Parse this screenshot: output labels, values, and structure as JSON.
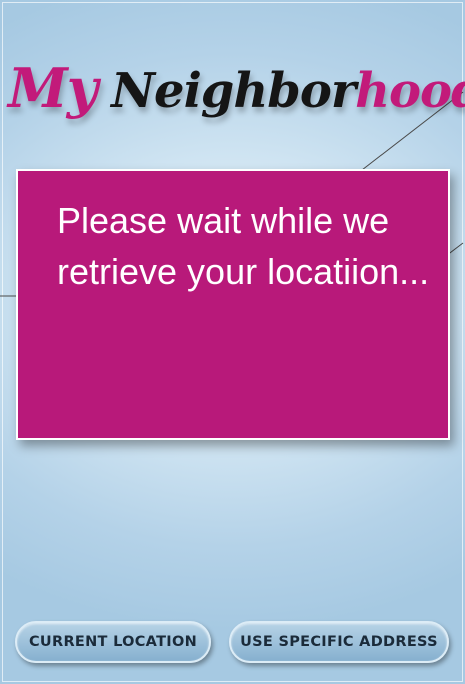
{
  "app": {
    "logo": {
      "part1": "My",
      "part2": "Neighbor",
      "part3": "hood"
    }
  },
  "dialog": {
    "message": "Please wait while we retrieve your locatiion..."
  },
  "buttons": {
    "current_location": "CURRENT LOCATION",
    "specific_address": "USE SPECIFIC ADDRESS"
  },
  "colors": {
    "accent": "#b8197a",
    "logo_dark": "#151515",
    "background": "#cfe4f2"
  }
}
